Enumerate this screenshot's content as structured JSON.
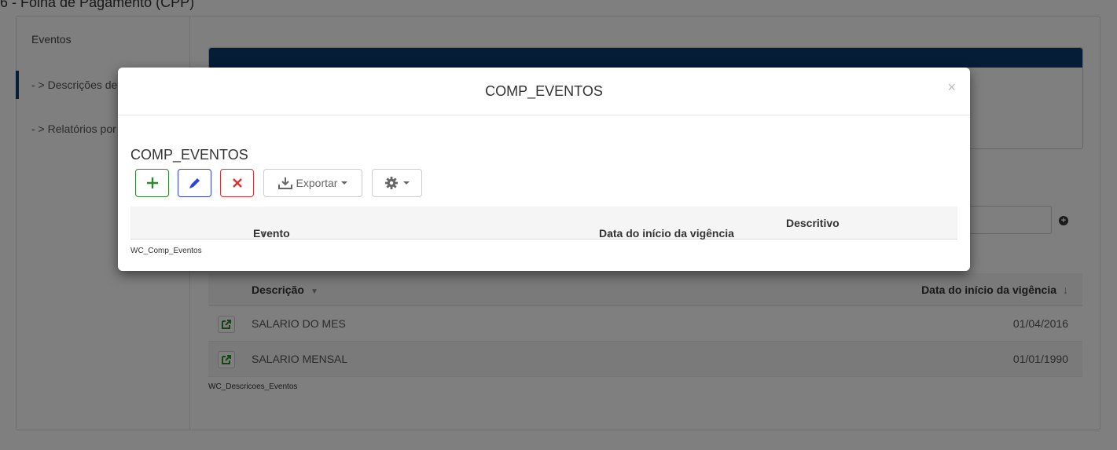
{
  "page": {
    "title": "6 - Folha de Pagamento (CPP)"
  },
  "sidebar": {
    "heading": "Eventos",
    "items": [
      {
        "label": "- > Descrições de Eventos",
        "active": true
      },
      {
        "label": "- > Relatórios por Eventos",
        "active": false
      }
    ]
  },
  "background_table": {
    "columns": [
      "Descrição",
      "Data do início da vigência"
    ],
    "sort_desc_caret": "▼",
    "sort_date_arrow": "↓",
    "rows": [
      {
        "descricao": "SALARIO DO MES",
        "data": "01/04/2016"
      },
      {
        "descricao": "SALARIO MENSAL",
        "data": "01/01/1990"
      }
    ],
    "label": "WC_Descricoes_Eventos"
  },
  "modal": {
    "title": "COMP_EVENTOS",
    "close": "×",
    "subtitle": "COMP_EVENTOS",
    "toolbar": {
      "add_icon": "plus-icon",
      "edit_icon": "pencil-icon",
      "delete_icon": "x-icon",
      "export_label": "Exportar",
      "settings_icon": "gear-icon"
    },
    "columns": [
      "Evento",
      "Data do início da vigência",
      "Descritivo"
    ],
    "sort_arrow": "↑",
    "label": "WC_Comp_Eventos"
  },
  "colors": {
    "accent": "#0b3a6e",
    "add": "#2a8a2a",
    "edit": "#2e42e0",
    "delete": "#e03030"
  }
}
